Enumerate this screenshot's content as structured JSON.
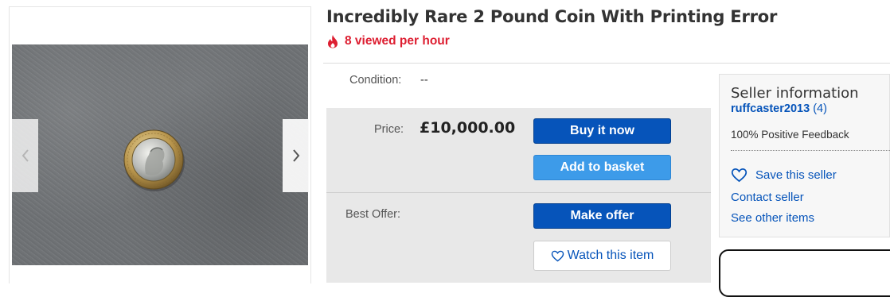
{
  "listing": {
    "title": "Incredibly Rare 2 Pound Coin With Printing Error",
    "views": "8 viewed per hour"
  },
  "condition": {
    "label": "Condition:",
    "value": "--"
  },
  "price": {
    "label": "Price:",
    "value": "£10,000.00"
  },
  "best_offer": {
    "label": "Best Offer:"
  },
  "buttons": {
    "buy_now": "Buy it now",
    "add_basket": "Add to basket",
    "make_offer": "Make offer",
    "watch": "Watch this item"
  },
  "seller": {
    "heading": "Seller information",
    "username": "ruffcaster2013",
    "feedback_count": "(4)",
    "feedback": "100% Positive Feedback",
    "save": "Save this seller",
    "contact": "Contact seller",
    "other_items": "See other items"
  },
  "icons": {
    "flame": "flame-icon",
    "prev": "chevron-left-icon",
    "next": "chevron-right-icon",
    "heart": "heart-icon"
  },
  "colors": {
    "ebay_blue": "#0654ba",
    "basket_blue": "#3d9be9",
    "hot_red": "#dd1e31",
    "panel_grey": "#e8e8e8"
  }
}
